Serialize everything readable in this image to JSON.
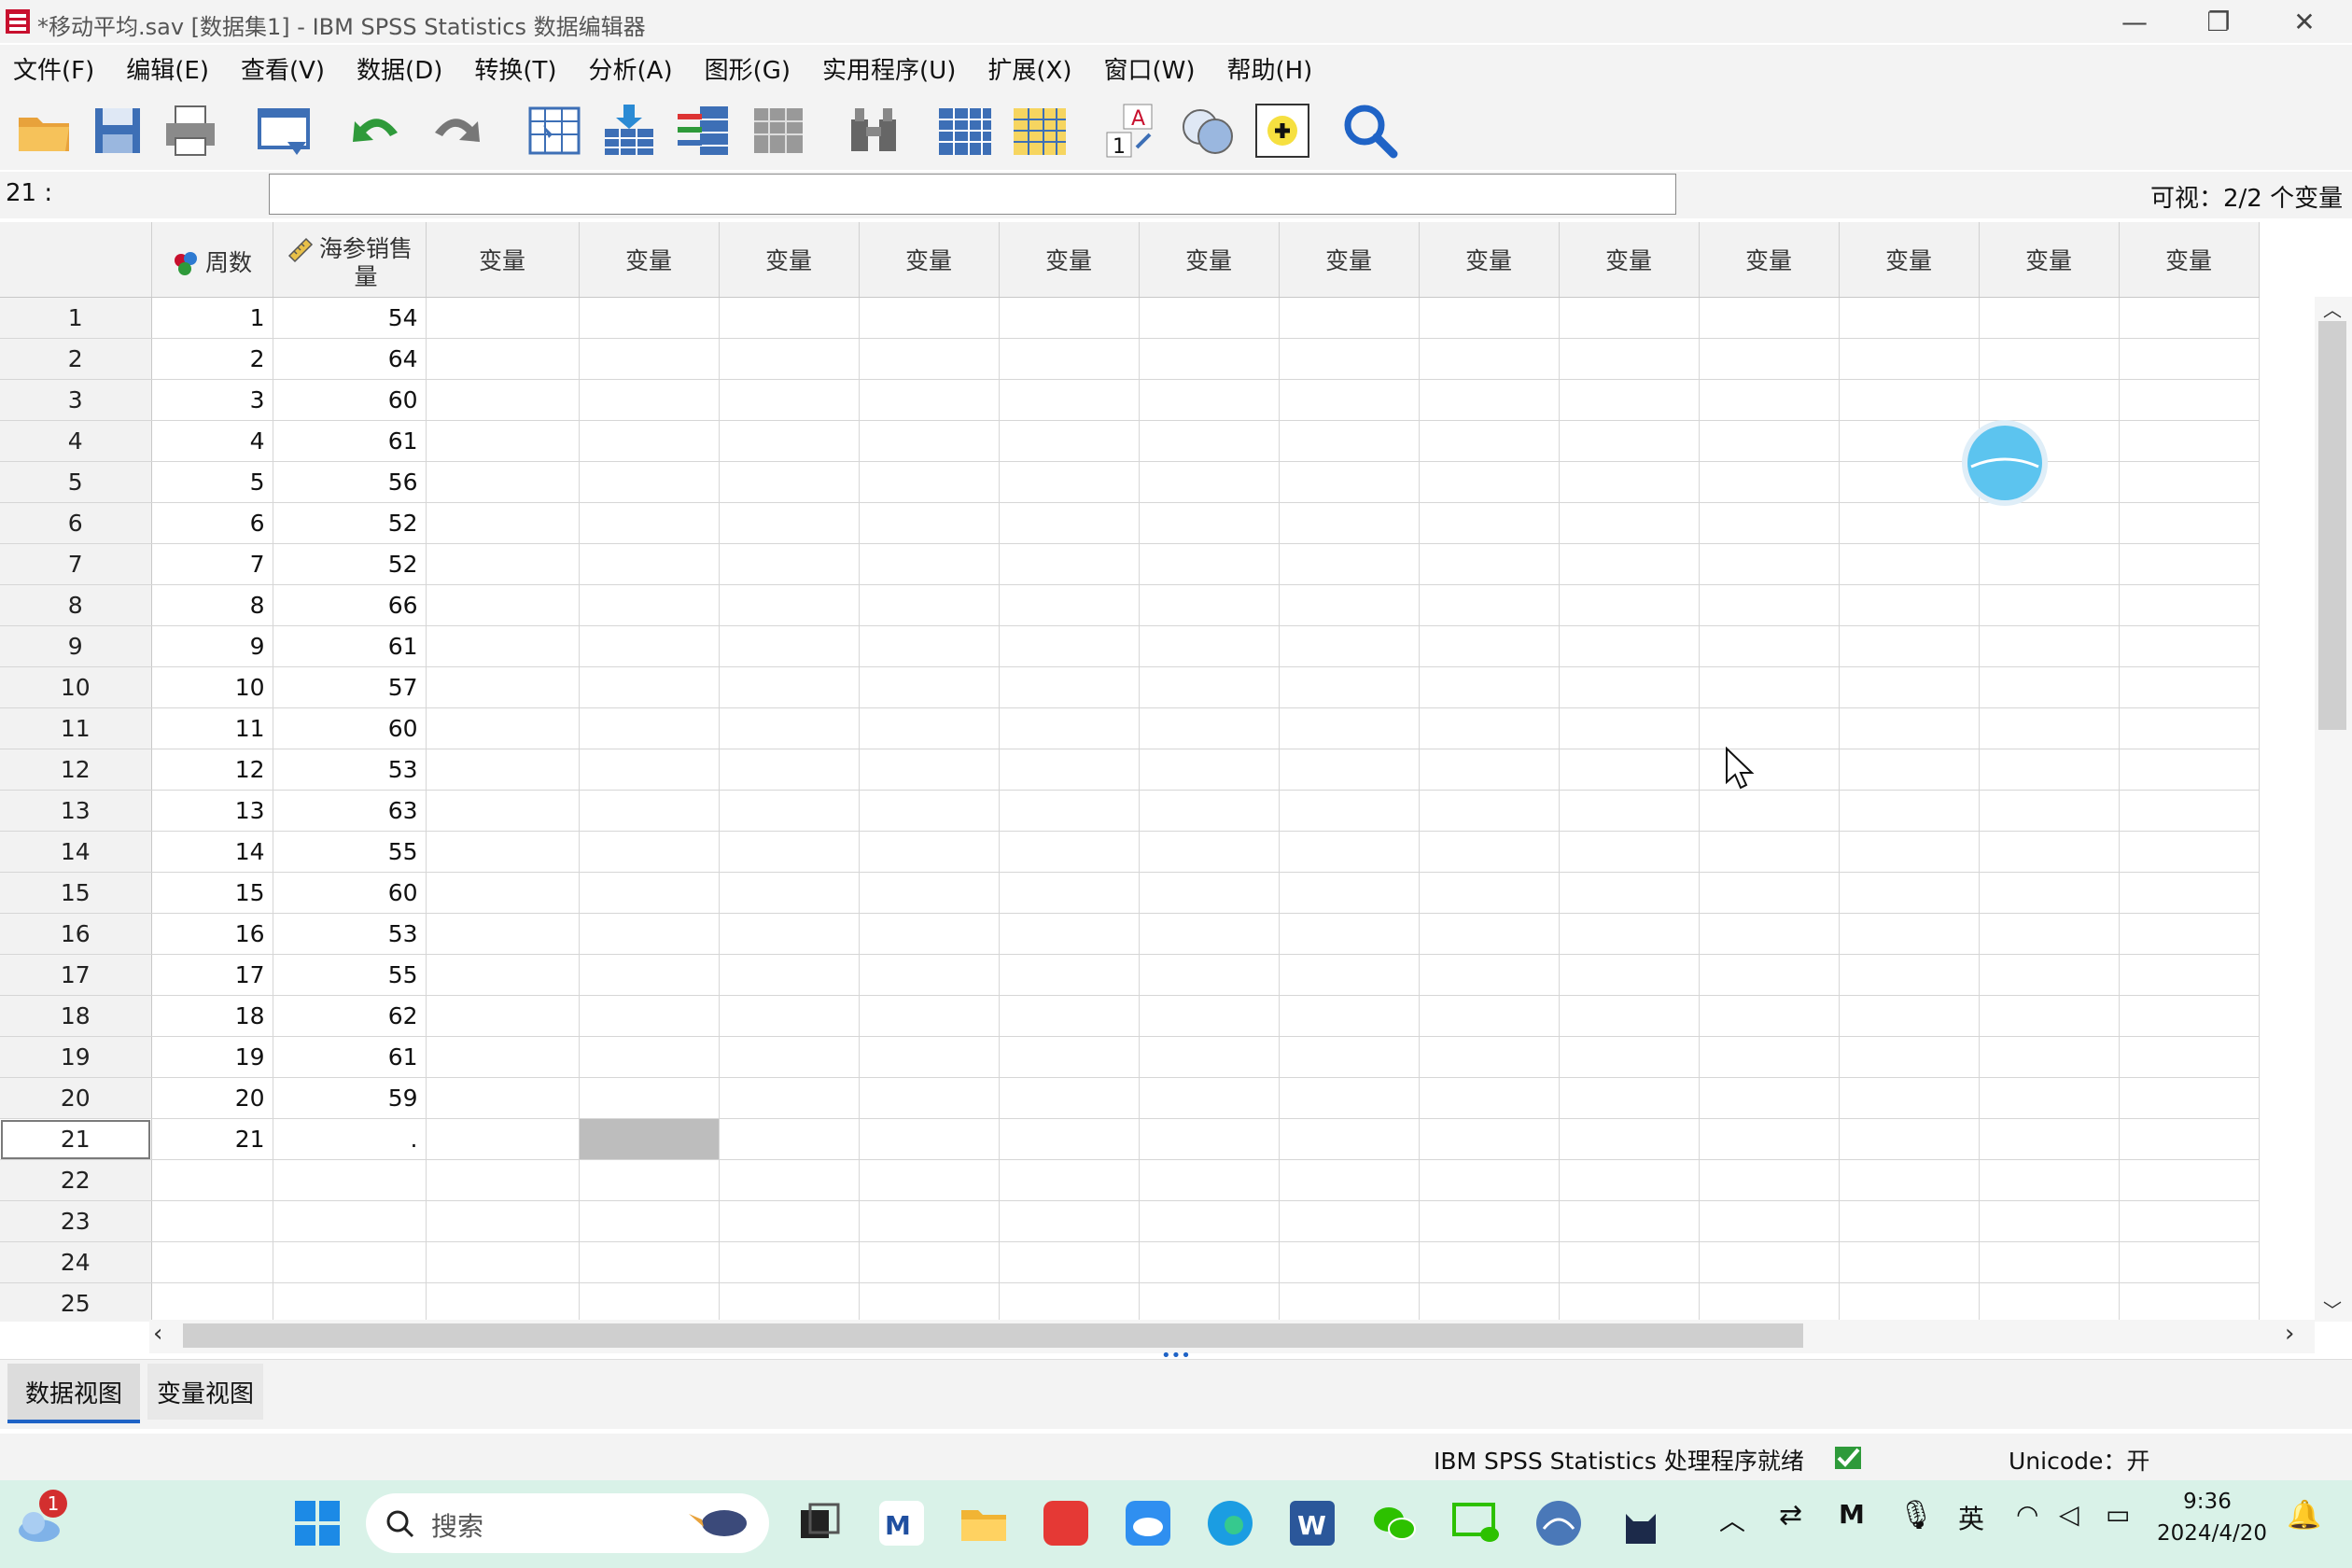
{
  "window": {
    "title": "*移动平均.sav [数据集1] - IBM SPSS Statistics 数据编辑器"
  },
  "menu": [
    "文件(F)",
    "编辑(E)",
    "查看(V)",
    "数据(D)",
    "转换(T)",
    "分析(A)",
    "图形(G)",
    "实用程序(U)",
    "扩展(X)",
    "窗口(W)",
    "帮助(H)"
  ],
  "editbar": {
    "cell_ref": "21 :",
    "cell_value": "",
    "visible": "可视：2/2 个变量"
  },
  "grid": {
    "columns": [
      "周数",
      "海参销售量"
    ],
    "var_placeholder": "变量",
    "empty_columns": 13,
    "rows": [
      [
        "1",
        "54"
      ],
      [
        "2",
        "64"
      ],
      [
        "3",
        "60"
      ],
      [
        "4",
        "61"
      ],
      [
        "5",
        "56"
      ],
      [
        "6",
        "52"
      ],
      [
        "7",
        "52"
      ],
      [
        "8",
        "66"
      ],
      [
        "9",
        "61"
      ],
      [
        "10",
        "57"
      ],
      [
        "11",
        "60"
      ],
      [
        "12",
        "53"
      ],
      [
        "13",
        "63"
      ],
      [
        "14",
        "55"
      ],
      [
        "15",
        "60"
      ],
      [
        "16",
        "53"
      ],
      [
        "17",
        "55"
      ],
      [
        "18",
        "62"
      ],
      [
        "19",
        "61"
      ],
      [
        "20",
        "59"
      ],
      [
        "21",
        "."
      ]
    ],
    "total_rows": 25,
    "selected_row": 21
  },
  "tabs": {
    "data_view": "数据视图",
    "variable_view": "变量视图",
    "active": "数据视图"
  },
  "status": {
    "processor": "IBM SPSS Statistics 处理程序就绪",
    "unicode": "Unicode：开"
  },
  "taskbar": {
    "search_placeholder": "搜索",
    "notification_count": "1",
    "ime": "英",
    "time": "9:36",
    "date": "2024/4/20"
  }
}
